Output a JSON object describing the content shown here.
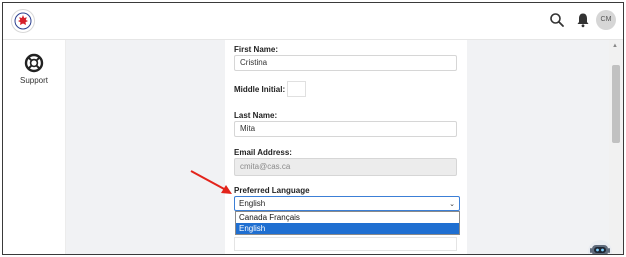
{
  "app": {
    "logo_icon": "maple-leaf-logo",
    "user_initials": "CM",
    "topbar_icons": [
      "search-icon",
      "bell-icon"
    ]
  },
  "sidebar": {
    "support_label": "Support",
    "support_icon": "lifebuoy-icon"
  },
  "form": {
    "first_name_label": "First Name:",
    "first_name_value": "Cristina",
    "middle_initial_label": "Middle Initial:",
    "middle_initial_value": "",
    "last_name_label": "Last Name:",
    "last_name_value": "Mita",
    "email_label": "Email Address:",
    "email_value": "cmita@cas.ca",
    "language_label": "Preferred Language",
    "language_selected": "English",
    "language_options": [
      "Canada Français",
      "English"
    ]
  },
  "colors": {
    "accent": "#1f6fd1",
    "annotation_arrow": "#e3241b"
  }
}
